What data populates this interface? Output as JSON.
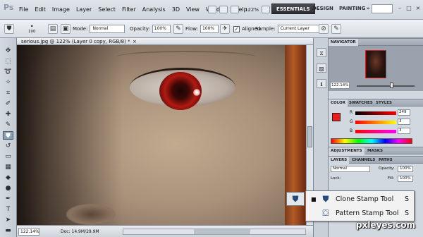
{
  "app": {
    "logo": "Ps"
  },
  "menubar": {
    "items": [
      "File",
      "Edit",
      "Image",
      "Layer",
      "Select",
      "Filter",
      "Analysis",
      "3D",
      "View",
      "Window",
      "Help"
    ],
    "zoom": "122%",
    "workspaces": [
      "ESSENTIALS",
      "DESIGN",
      "PAINTING",
      "»"
    ],
    "window_controls": [
      "–",
      "□",
      "×"
    ]
  },
  "options": {
    "brush_size": "100",
    "mode_label": "Mode:",
    "mode_value": "Normal",
    "opacity_label": "Opacity:",
    "opacity_value": "100%",
    "flow_label": "Flow:",
    "flow_value": "100%",
    "aligned_label": "Aligned",
    "sample_label": "Sample:",
    "sample_value": "Current Layer"
  },
  "document": {
    "tab_title": "serious.jpg @ 122% (Layer 0 copy, RGB/8) *",
    "close": "×"
  },
  "status": {
    "zoom": "122.14%",
    "doc": "Doc: 14.9M/29.9M"
  },
  "panels": {
    "navigator_tab": "NAVIGATOR",
    "navigator_zoom": "122.14%",
    "color_tabs": [
      "COLOR",
      "SWATCHES",
      "STYLES"
    ],
    "color_channels": [
      {
        "label": "R",
        "value": "249"
      },
      {
        "label": "G",
        "value": "3"
      },
      {
        "label": "B",
        "value": "3"
      }
    ],
    "adjust_tabs": [
      "ADJUSTMENTS",
      "MASKS"
    ],
    "layers_tabs": [
      "LAYERS",
      "CHANNELS",
      "PATHS"
    ],
    "blend_mode": "Normal",
    "layer_opacity_label": "Opacity:",
    "layer_opacity_value": "100%",
    "lock_label": "Lock:",
    "fill_label": "Fill:",
    "fill_value": "100%"
  },
  "flyout": {
    "items": [
      {
        "bullet": "■",
        "label": "Clone Stamp Tool",
        "key": "S"
      },
      {
        "bullet": "",
        "label": "Pattern Stamp Tool",
        "key": "S"
      }
    ]
  },
  "watermark": "pxleyes.com",
  "colors": {
    "foreground": "#ee1c1c",
    "accent": "#b01a12"
  }
}
